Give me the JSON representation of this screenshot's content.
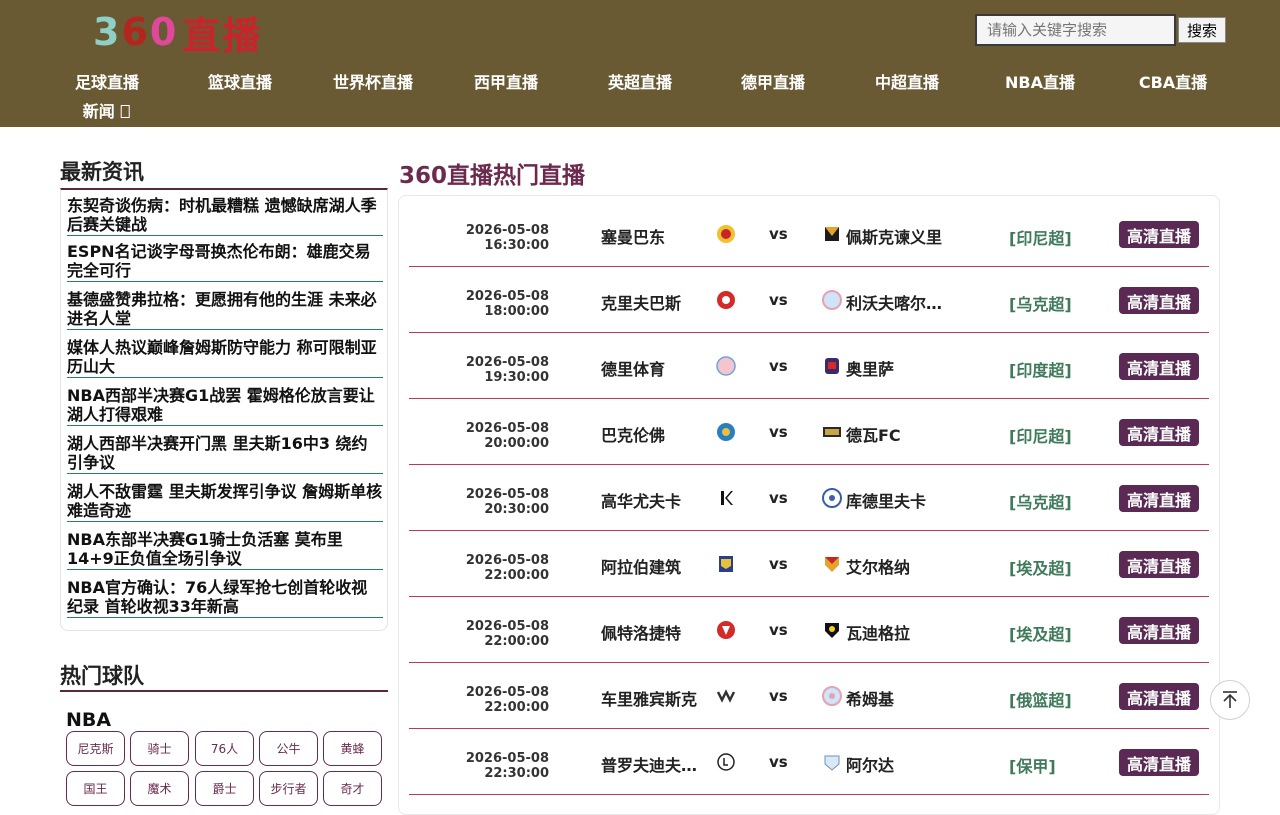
{
  "header": {
    "logo": {
      "d3": "3",
      "d6": "6",
      "d0": "0",
      "zb": "直播"
    },
    "search": {
      "placeholder": "请输入关键字搜索",
      "button_label": "搜索"
    },
    "nav": [
      "足球直播",
      "篮球直播",
      "世界杯直播",
      "西甲直播",
      "英超直播",
      "德甲直播",
      "中超直播",
      "NBA直播",
      "CBA直播"
    ],
    "nav_news": "新闻 "
  },
  "sidebar": {
    "news_title": "最新资讯",
    "news": [
      "东契奇谈伤病：时机最糟糕 遗憾缺席湖人季后赛关键战",
      "ESPN名记谈字母哥换杰伦布朗：雄鹿交易完全可行",
      "基德盛赞弗拉格：更愿拥有他的生涯 未来必进名人堂",
      "媒体人热议巅峰詹姆斯防守能力 称可限制亚历山大",
      "NBA西部半决赛G1战罢 霍姆格伦放言要让湖人打得艰难",
      "湖人西部半决赛开门黑 里夫斯16中3 绕约引争议",
      "湖人不敌雷霆 里夫斯发挥引争议 詹姆斯单核难造奇迹",
      "NBA东部半决赛G1骑士负活塞 莫布里14+9正负值全场引争议",
      "NBA官方确认：76人绿军抢七创首轮收视纪录 首轮收视33年新高"
    ],
    "teams_title": "热门球队",
    "league": "NBA",
    "teams": [
      "尼克斯",
      "骑士",
      "76人",
      "公牛",
      "黄蜂",
      "国王",
      "魔术",
      "爵士",
      "步行者",
      "奇才"
    ]
  },
  "main": {
    "title": "360直播热门直播",
    "vs": "vs",
    "btn_label": "高清直播",
    "matches": [
      {
        "date": "2026-05-08",
        "time": "16:30:00",
        "home": "塞曼巴东",
        "away": "佩斯克谏义里",
        "league": "[印尼超]"
      },
      {
        "date": "2026-05-08",
        "time": "18:00:00",
        "home": "克里夫巴斯",
        "away": "利沃夫喀尔巴阡",
        "league": "[乌克超]"
      },
      {
        "date": "2026-05-08",
        "time": "19:30:00",
        "home": "德里体育",
        "away": "奥里萨",
        "league": "[印度超]"
      },
      {
        "date": "2026-05-08",
        "time": "20:00:00",
        "home": "巴克伦佛",
        "away": "德瓦FC",
        "league": "[印尼超]"
      },
      {
        "date": "2026-05-08",
        "time": "20:30:00",
        "home": "高华尤夫卡",
        "away": "库德里夫卡",
        "league": "[乌克超]"
      },
      {
        "date": "2026-05-08",
        "time": "22:00:00",
        "home": "阿拉伯建筑",
        "away": "艾尔格纳",
        "league": "[埃及超]"
      },
      {
        "date": "2026-05-08",
        "time": "22:00:00",
        "home": "佩特洛捷特",
        "away": "瓦迪格拉",
        "league": "[埃及超]"
      },
      {
        "date": "2026-05-08",
        "time": "22:00:00",
        "home": "车里雅宾斯克",
        "away": "希姆基",
        "league": "[俄篮超]"
      },
      {
        "date": "2026-05-08",
        "time": "22:30:00",
        "home": "普罗夫迪夫火车头",
        "away": "阿尔达",
        "league": "[保甲]"
      }
    ]
  },
  "colors": {
    "header_bg": "#6a5a34",
    "accent": "#6b2a4e",
    "league_green": "#3f7a5a",
    "row_line": "#b8395e"
  },
  "icons": {
    "back_to_top": "arrow-up-icon",
    "nav_news": "box-glyph-icon"
  }
}
